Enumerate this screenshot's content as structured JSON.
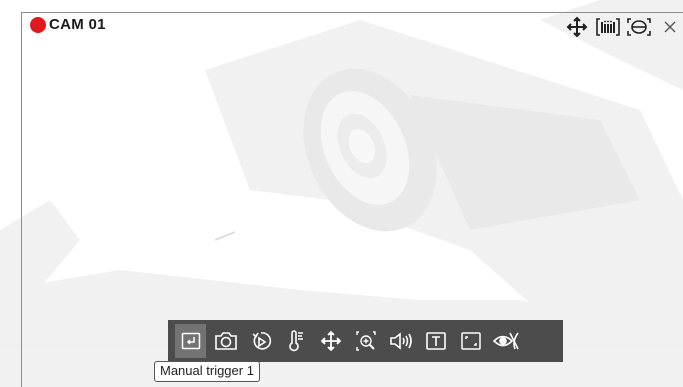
{
  "camera": {
    "name": "CAM 01",
    "recording_color": "#e0191f"
  },
  "top_toolbar": {
    "icons": [
      "move-icon",
      "barcode-icon",
      "fisheye-icon",
      "close-icon"
    ]
  },
  "bottom_toolbar": {
    "active_index": 0,
    "buttons": [
      "manual-trigger-icon",
      "snapshot-icon",
      "playback-icon",
      "thermometer-icon",
      "ptz-move-icon",
      "digital-zoom-icon",
      "audio-icon",
      "text-overlay-icon",
      "fullscreen-icon",
      "privacy-mask-icon"
    ]
  },
  "tooltip": {
    "text": "Manual trigger 1"
  },
  "colors": {
    "toolbar_bg": "#3e3e3e",
    "icon": "#ffffff",
    "top_icon": "#222222"
  }
}
